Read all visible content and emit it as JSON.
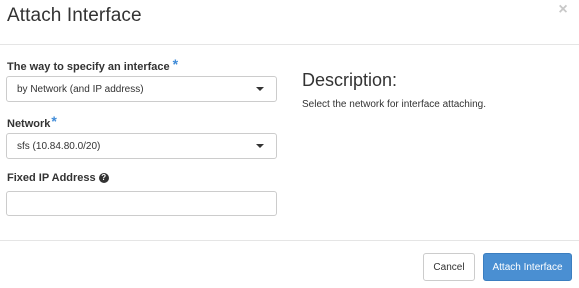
{
  "dialog": {
    "title": "Attach Interface",
    "close_icon": "×"
  },
  "form": {
    "interface_way": {
      "label": "The way to specify an interface",
      "required_mark": "*",
      "selected": "by Network (and IP address)"
    },
    "network": {
      "label": "Network",
      "required_mark": "*",
      "selected": "sfs (10.84.80.0/20)"
    },
    "fixed_ip": {
      "label": "Fixed IP Address",
      "help_icon": "?",
      "value": "",
      "placeholder": ""
    }
  },
  "description": {
    "heading": "Description:",
    "text": "Select the network for interface attaching."
  },
  "footer": {
    "cancel_label": "Cancel",
    "submit_label": "Attach Interface"
  },
  "colors": {
    "primary": "#4a8fd2",
    "required": "#3f8bd8"
  }
}
